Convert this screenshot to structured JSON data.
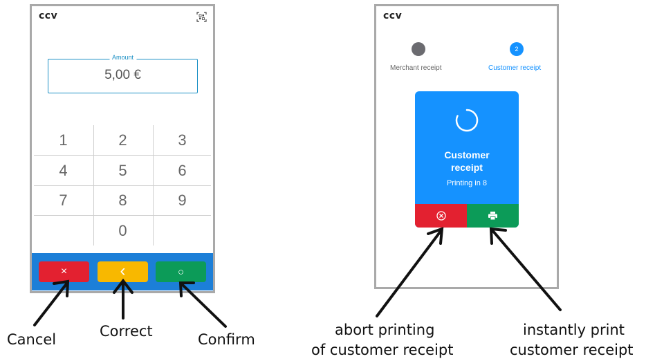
{
  "left_terminal": {
    "logo": "ccv",
    "icons": {
      "scan": "qr-scan-icon"
    },
    "amount": {
      "label": "Amount",
      "value": "5,00 €"
    },
    "keypad": [
      "1",
      "2",
      "3",
      "4",
      "5",
      "6",
      "7",
      "8",
      "9",
      "",
      "0",
      ""
    ],
    "buttons": [
      {
        "name": "cancel",
        "glyph": "×",
        "icon": "close-icon",
        "color": "#e32130"
      },
      {
        "name": "correct",
        "glyph": "‹",
        "icon": "chevron-left-icon",
        "color": "#f8b800"
      },
      {
        "name": "confirm",
        "glyph": "○",
        "icon": "circle-icon",
        "color": "#0c9b58"
      }
    ],
    "bar_color": "#1c7fd8"
  },
  "right_terminal": {
    "logo": "ccv",
    "steps": [
      {
        "label": "Merchant receipt",
        "number": "",
        "color": "#6b6b70"
      },
      {
        "label": "Customer receipt",
        "number": "2",
        "color": "#1592ff"
      }
    ],
    "card": {
      "title_line1": "Customer",
      "title_line2": "receipt",
      "status": "Printing in 8",
      "color": "#1592ff",
      "abort_icon": "cancel-circle-icon",
      "print_icon": "printer-icon",
      "abort_color": "#e32130",
      "print_color": "#0c9b58"
    }
  },
  "captions": {
    "cancel": "Cancel",
    "correct": "Correct",
    "confirm": "Confirm",
    "abort_line1": "abort printing",
    "abort_line2": "of customer receipt",
    "print_line1": "instantly print",
    "print_line2": "customer receipt"
  }
}
